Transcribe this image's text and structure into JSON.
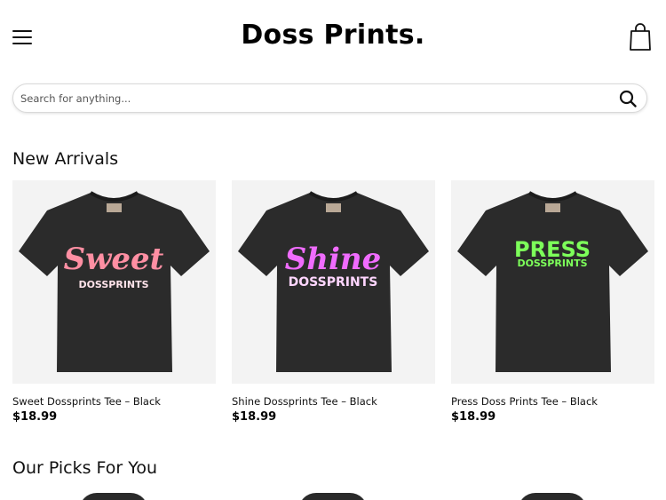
{
  "header": {
    "logo": "Doss Prints.",
    "menu_icon": "hamburger-menu-icon",
    "cart_icon": "shopping-bag-icon"
  },
  "search": {
    "placeholder": "Search for anything...",
    "icon": "search-icon"
  },
  "sections": {
    "new_arrivals": "New Arrivals",
    "picks": "Our Picks For You"
  },
  "products": [
    {
      "name": "Sweet Dossprints Tee – Black",
      "price": "$18.99",
      "print_main": "Sweet",
      "print_sub": "DOSSPRINTS",
      "print_color": "#ff8fa3"
    },
    {
      "name": "Shine Dossprints Tee – Black",
      "price": "$18.99",
      "print_main": "Shine",
      "print_sub": "DOSSPRINTS",
      "print_color": "#f06cff"
    },
    {
      "name": "Press Doss Prints Tee – Black",
      "price": "$18.99",
      "print_main": "PRESS",
      "print_sub": "DOSSPRINTS",
      "print_color": "#7dff5a"
    }
  ],
  "colors": {
    "tee": "#2b2b2b",
    "image_bg": "#f3f3f3"
  }
}
